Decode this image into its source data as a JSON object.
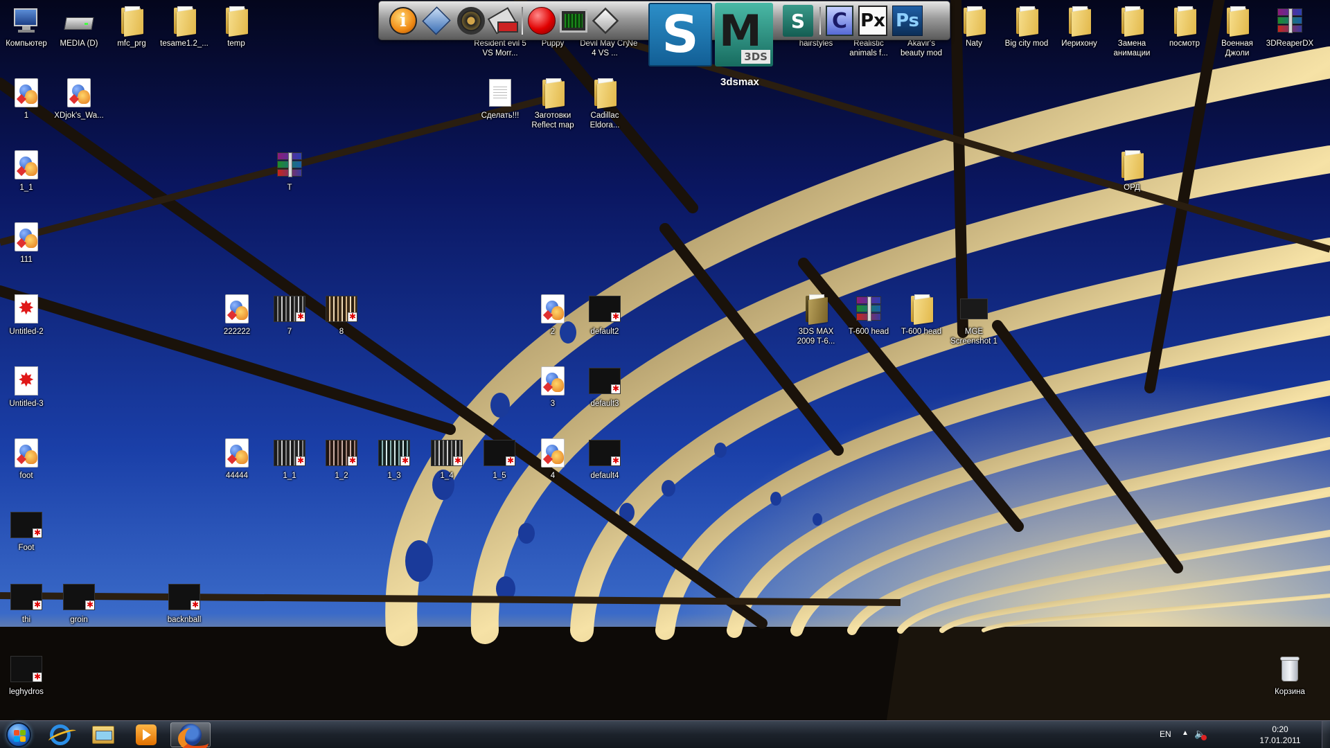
{
  "desktop": {
    "top_row": [
      {
        "label": "Компьютер"
      },
      {
        "label": "MEDIA (D)"
      },
      {
        "label": "mfc_prg"
      },
      {
        "label": "tesame1.2_..."
      },
      {
        "label": "temp"
      }
    ],
    "left_column": [
      {
        "label": "1"
      },
      {
        "label": "XDjok's_Wa..."
      },
      {
        "label": "1_1"
      },
      {
        "label": "T"
      },
      {
        "label": "111"
      },
      {
        "label": "Untitled-2"
      },
      {
        "label": "Untitled-3"
      },
      {
        "label": "foot"
      },
      {
        "label": "Foot"
      },
      {
        "label": "thi"
      },
      {
        "label": "groin"
      },
      {
        "label": "backnball"
      },
      {
        "label": "leghydros"
      }
    ],
    "middle": [
      {
        "label": "222222"
      },
      {
        "label": "7"
      },
      {
        "label": "8"
      },
      {
        "label": "2"
      },
      {
        "label": "default2"
      },
      {
        "label": "3"
      },
      {
        "label": "default3"
      },
      {
        "label": "44444"
      },
      {
        "label": "1_1"
      },
      {
        "label": "1_2"
      },
      {
        "label": "1_3"
      },
      {
        "label": "1_4"
      },
      {
        "label": "1_5"
      },
      {
        "label": "4"
      },
      {
        "label": "default4"
      }
    ],
    "dock_row_labels": [
      {
        "label": "Resident evil 5 VS Morr..."
      },
      {
        "label": "Puppy"
      },
      {
        "label": "Devil May Cry 4 VS ..."
      },
      {
        "label": "Ne"
      },
      {
        "label": "hairstyles"
      },
      {
        "label": "Realistic animals f..."
      },
      {
        "label": "Akavir's beauty mod"
      }
    ],
    "second_row": [
      {
        "label": "Сделать!!!"
      },
      {
        "label": "Заготовки Reflect map"
      },
      {
        "label": "Cadillac Eldora..."
      }
    ],
    "right_top": [
      {
        "label": "Naty"
      },
      {
        "label": "Big city mod"
      },
      {
        "label": "Иерихону"
      },
      {
        "label": "Замена анимации"
      },
      {
        "label": "посмотр"
      },
      {
        "label": "Военная Джоли"
      },
      {
        "label": "3DReaperDX"
      }
    ],
    "right_misc": [
      {
        "label": "ОРД"
      },
      {
        "label": "3DS MAX 2009 T-6..."
      },
      {
        "label": "T-600 head"
      },
      {
        "label": "T-600 head"
      },
      {
        "label": "MGE Screenshot 1"
      },
      {
        "label": "Корзина"
      }
    ]
  },
  "dock": {
    "tooltip": "3dsmax",
    "icons": [
      "info-icon",
      "virtualbox-icon",
      "wheel-icon",
      "gun-icon",
      "red-ball-icon",
      "monitor-icon",
      "cube-icon",
      "3dsmax-icon",
      "maya-icon",
      "3dsmax-small-icon",
      "c-icon",
      "px-icon",
      "photoshop-icon"
    ],
    "maya_tag": "3DS",
    "c_text": "C",
    "px_text": "Px",
    "ps_text": "Ps",
    "info_text": "i"
  },
  "taskbar": {
    "icons": [
      "start-orb-icon",
      "internet-explorer-icon",
      "explorer-icon",
      "media-player-icon",
      "firefox-icon"
    ],
    "language": "EN",
    "time": "0:20",
    "date": "17.01.2011"
  },
  "colors": {
    "sky_top": "#0a0f3a",
    "sky_mid": "#12308a",
    "horizon_glow": "#f2c66a",
    "taskbar": "#1c222b"
  }
}
